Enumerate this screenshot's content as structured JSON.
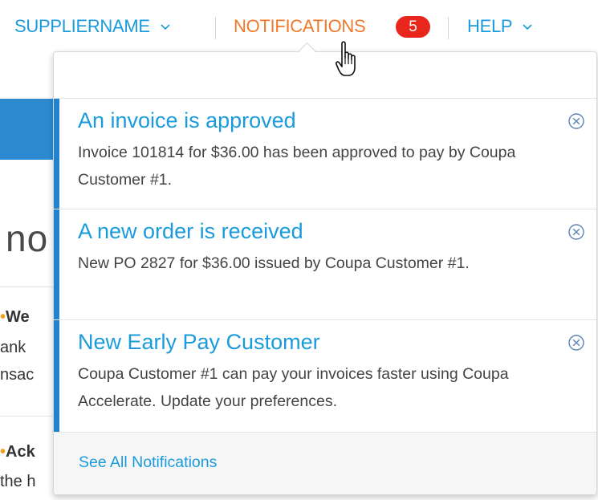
{
  "nav": {
    "supplier_label": "SUPPLIERNAME",
    "notifications_label": "NOTIFICATIONS",
    "notifications_count": "5",
    "help_label": "HELP"
  },
  "background_page": {
    "heading_fragment": "no",
    "item1_title_fragment": "We",
    "item1_line2_fragment": "ank",
    "item1_line3_fragment": "nsac",
    "item2_title_fragment": "Ack",
    "item2_line2_fragment": "the h"
  },
  "notifications": [
    {
      "title": "An invoice is approved",
      "body": "Invoice 101814 for $36.00 has been approved to pay by Coupa Customer #1."
    },
    {
      "title": "A new order is received",
      "body": "New PO 2827 for $36.00 issued by Coupa Customer #1."
    },
    {
      "title": "New Early Pay Customer",
      "body": "Coupa Customer #1 can pay your invoices faster using Coupa Accelerate. Update your preferences."
    }
  ],
  "see_all_label": "See All Notifications",
  "colors": {
    "link_blue": "#1a9bdc",
    "active_orange": "#f07a2a",
    "badge_red": "#e8261c",
    "accent_blue": "#1f83cf"
  },
  "icons": {
    "nav_chevron": "chevron-down-icon",
    "dismiss": "close-circle-icon",
    "pointer": "hand-pointer-cursor-icon"
  }
}
